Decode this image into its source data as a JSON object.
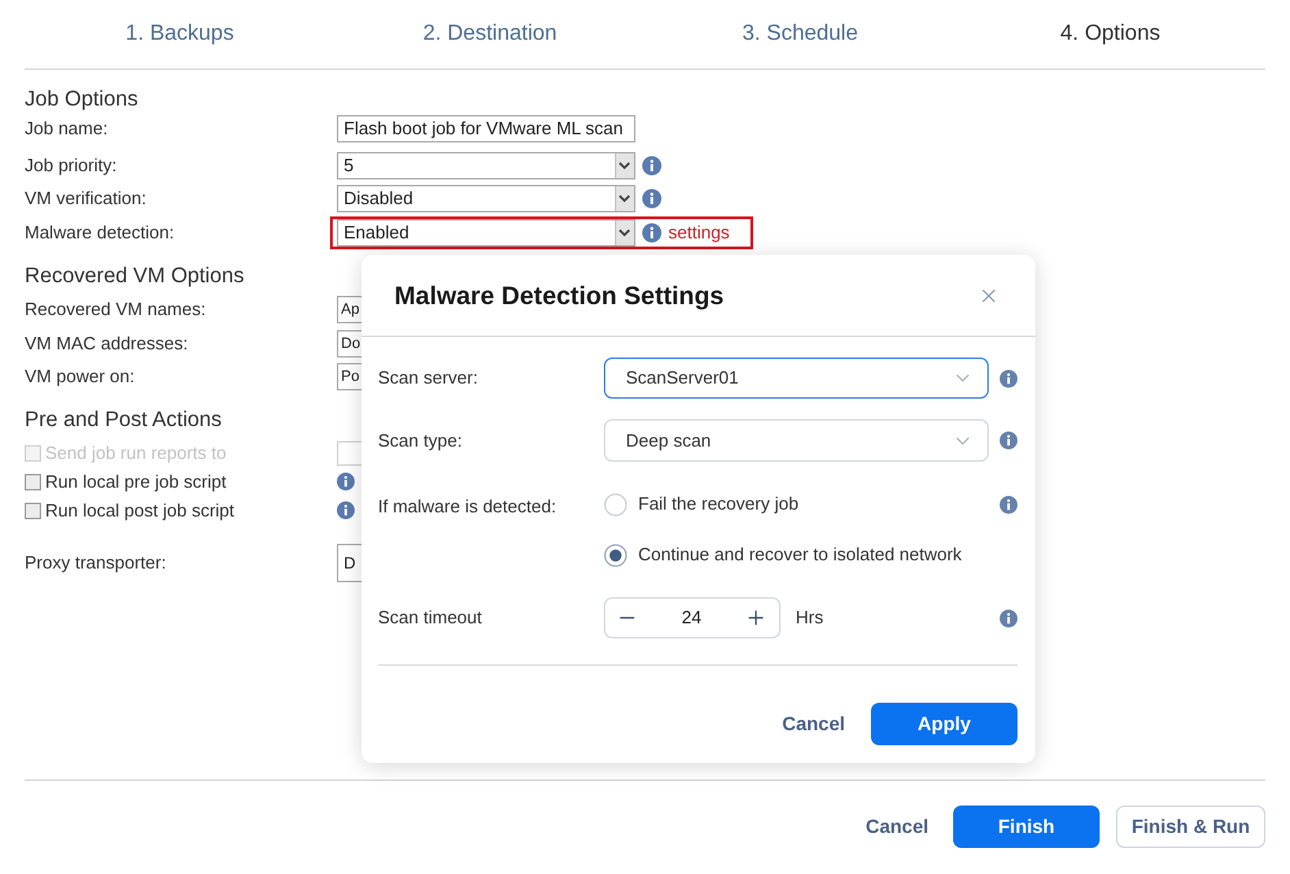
{
  "wizard_steps": [
    {
      "label": "1. Backups",
      "selected": false
    },
    {
      "label": "2. Destination",
      "selected": false
    },
    {
      "label": "3. Schedule",
      "selected": false
    },
    {
      "label": "4. Options",
      "selected": true
    }
  ],
  "job_options": {
    "title": "Job Options",
    "fields": [
      {
        "kind": "text",
        "label": "Job name:",
        "value": "Flash boot job for VMware ML scan",
        "info": false,
        "highlighted": false
      },
      {
        "kind": "select",
        "label": "Job priority:",
        "value": "5",
        "info": true,
        "highlighted": false
      },
      {
        "kind": "select",
        "label": "VM verification:",
        "value": "Disabled",
        "info": true,
        "highlighted": false
      },
      {
        "kind": "select",
        "label": "Malware detection:",
        "value": "Enabled",
        "info": true,
        "highlighted": true,
        "link": "settings"
      }
    ]
  },
  "recovered_vm_options": {
    "title": "Recovered VM Options",
    "fields": [
      {
        "label": "Recovered VM names:",
        "value": "Ap"
      },
      {
        "label": "VM MAC addresses:",
        "value": "Do"
      },
      {
        "label": "VM power on:",
        "value": "Po"
      }
    ]
  },
  "pre_post_actions": {
    "title": "Pre and Post Actions",
    "items": [
      {
        "kind": "field",
        "label": "Send job run reports to",
        "checked": false,
        "disabled": true
      },
      {
        "kind": "info",
        "label": "Run local pre job script",
        "checked": false,
        "disabled": false
      },
      {
        "kind": "info",
        "label": "Run local post job script",
        "checked": false,
        "disabled": false
      }
    ]
  },
  "proxy_transporter": {
    "label": "Proxy transporter:",
    "value": "D"
  },
  "dialog": {
    "title": "Malware Detection Settings",
    "fields": [
      {
        "kind": "select",
        "label": "Scan server:",
        "value": "ScanServer01",
        "focused": true,
        "info": true
      },
      {
        "kind": "select",
        "label": "Scan type:",
        "value": "Deep scan",
        "focused": false,
        "info": true
      },
      {
        "kind": "radio",
        "label": "If malware is detected:",
        "info": true,
        "options": [
          {
            "label": "Fail the recovery job",
            "selected": false
          },
          {
            "label": "Continue and recover to isolated network",
            "selected": true
          }
        ]
      },
      {
        "kind": "stepper",
        "label": "Scan timeout",
        "value": "24",
        "unit": "Hrs",
        "info": true
      }
    ],
    "buttons": [
      {
        "kind": "text",
        "label": "Cancel"
      },
      {
        "kind": "primary",
        "label": "Apply"
      }
    ]
  },
  "footer_buttons": [
    {
      "kind": "text",
      "label": "Cancel"
    },
    {
      "kind": "primary",
      "label": "Finish"
    },
    {
      "kind": "outline",
      "label": "Finish & Run"
    }
  ]
}
